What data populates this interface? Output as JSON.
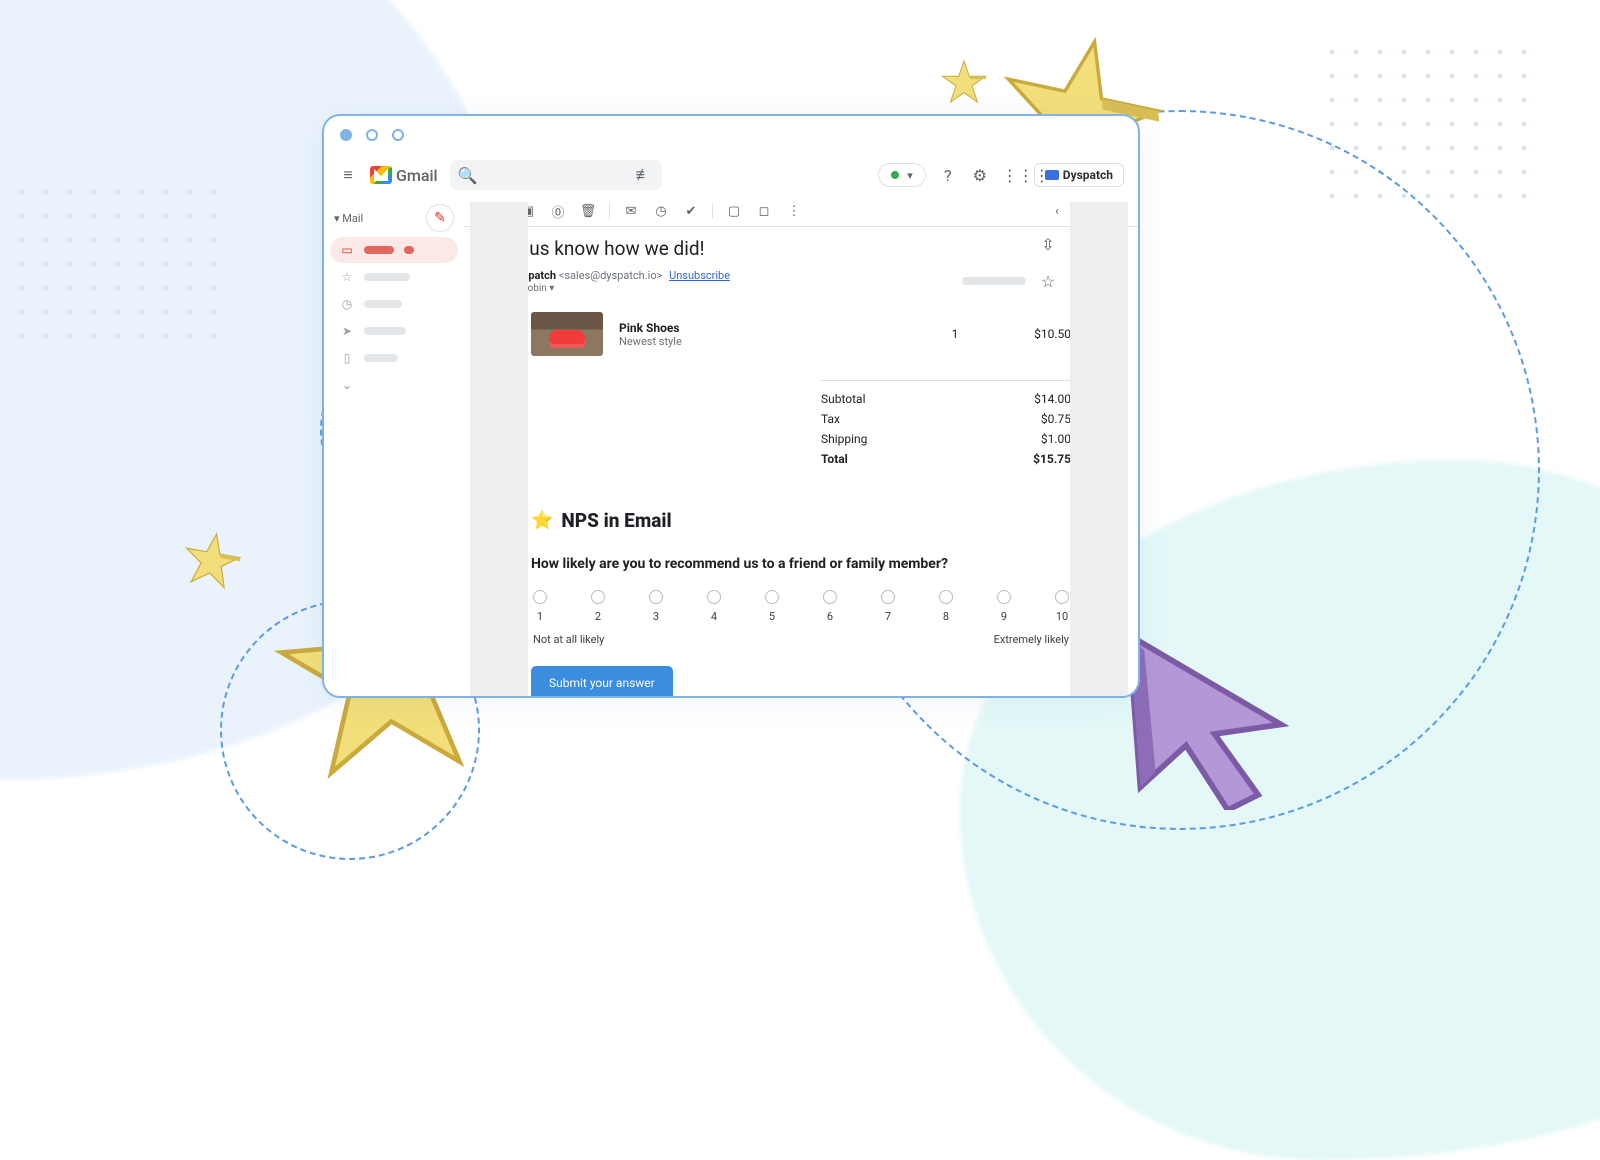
{
  "app": {
    "name": "Gmail",
    "brand_badge": "Dyspatch"
  },
  "sidebar": {
    "mail_label": "Mail",
    "items": [
      {
        "icon": "inbox",
        "active": true
      },
      {
        "icon": "star",
        "active": false
      },
      {
        "icon": "clock",
        "active": false
      },
      {
        "icon": "send",
        "active": false
      },
      {
        "icon": "file",
        "active": false
      },
      {
        "icon": "more",
        "active": false
      }
    ]
  },
  "email": {
    "subject": "Let us know how we did!",
    "sender_name": "Dyspatch",
    "sender_email": "<sales@dyspatch.io>",
    "unsubscribe": "Unsubscribe",
    "to_line": "to Robin",
    "product": {
      "name": "Pink Shoes",
      "sub": "Newest style",
      "qty": "1",
      "price": "$10.50"
    },
    "totals": {
      "subtotal_label": "Subtotal",
      "subtotal": "$14.00",
      "tax_label": "Tax",
      "tax": "$0.75",
      "shipping_label": "Shipping",
      "shipping": "$1.00",
      "total_label": "Total",
      "total": "$15.75"
    },
    "nps": {
      "heading": "NPS in Email",
      "question": "How likely are you to recommend us to a friend or family member?",
      "options": [
        "1",
        "2",
        "3",
        "4",
        "5",
        "6",
        "7",
        "8",
        "9",
        "10"
      ],
      "low_label": "Not at all likely",
      "high_label": "Extremely likely",
      "submit": "Submit your answer"
    }
  }
}
